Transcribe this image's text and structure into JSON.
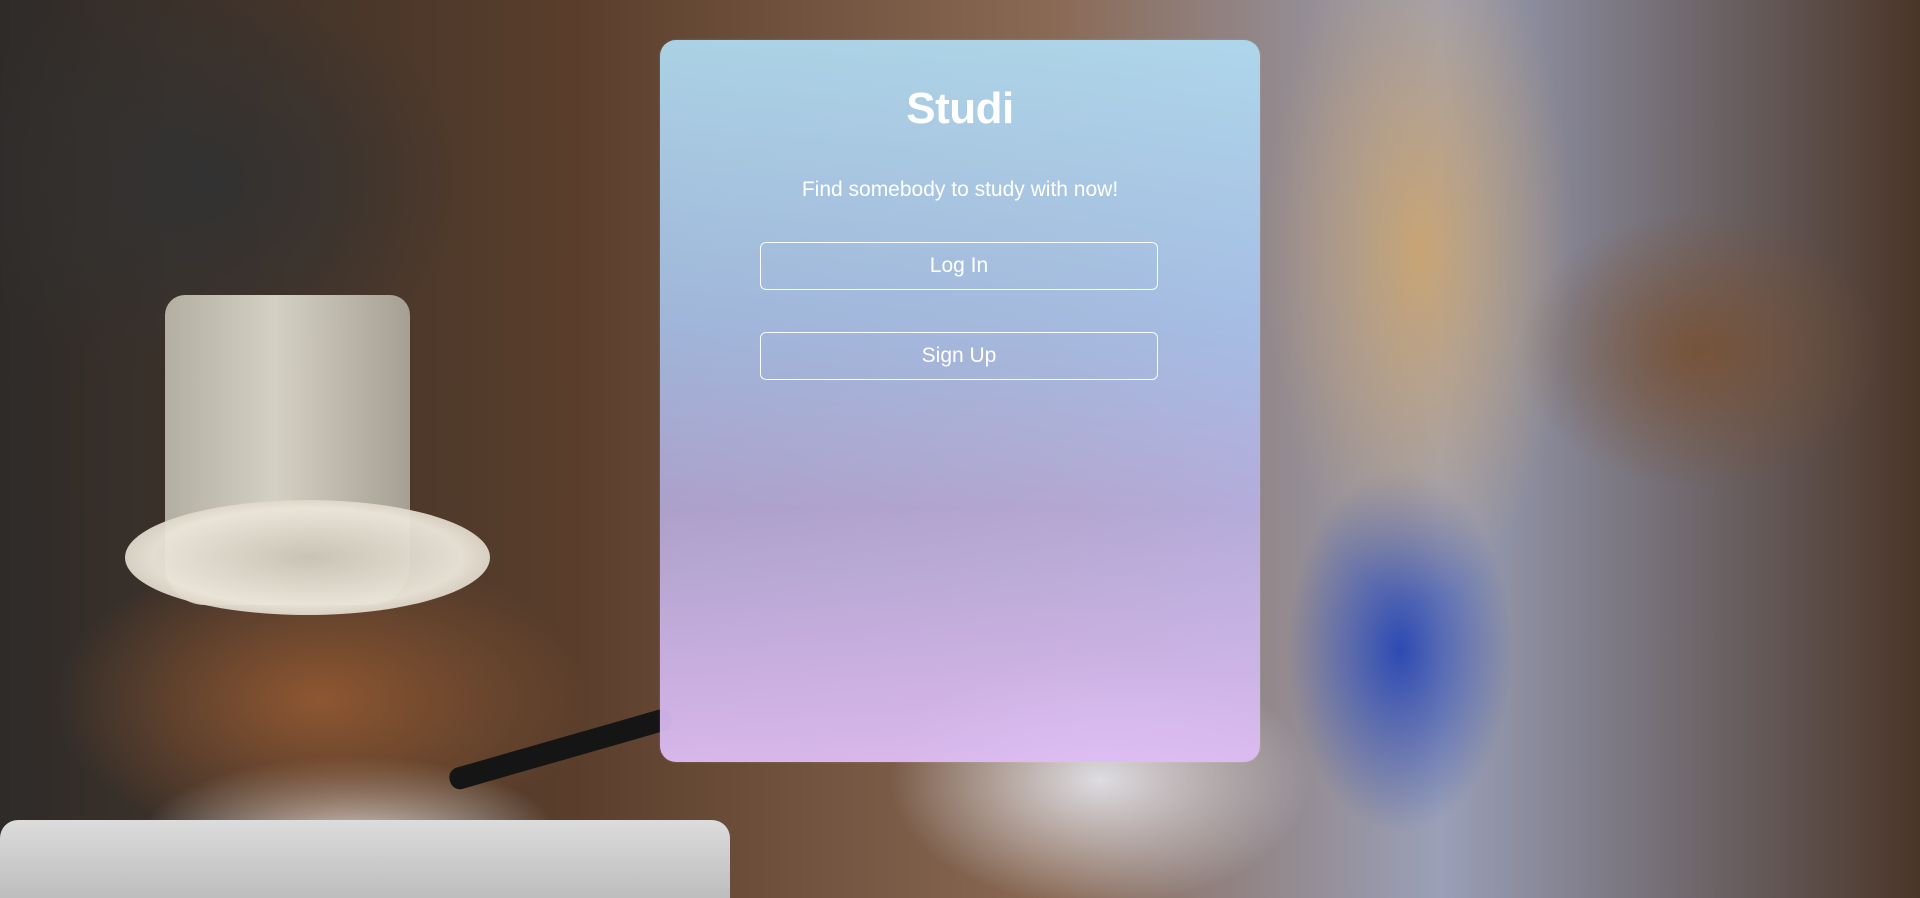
{
  "app": {
    "title": "Studi",
    "tagline": "Find somebody to study with now!"
  },
  "actions": {
    "login_label": "Log In",
    "signup_label": "Sign Up"
  },
  "colors": {
    "card_top": "#b0dcf2",
    "card_bottom": "#debcf4",
    "text": "#ffffff"
  }
}
